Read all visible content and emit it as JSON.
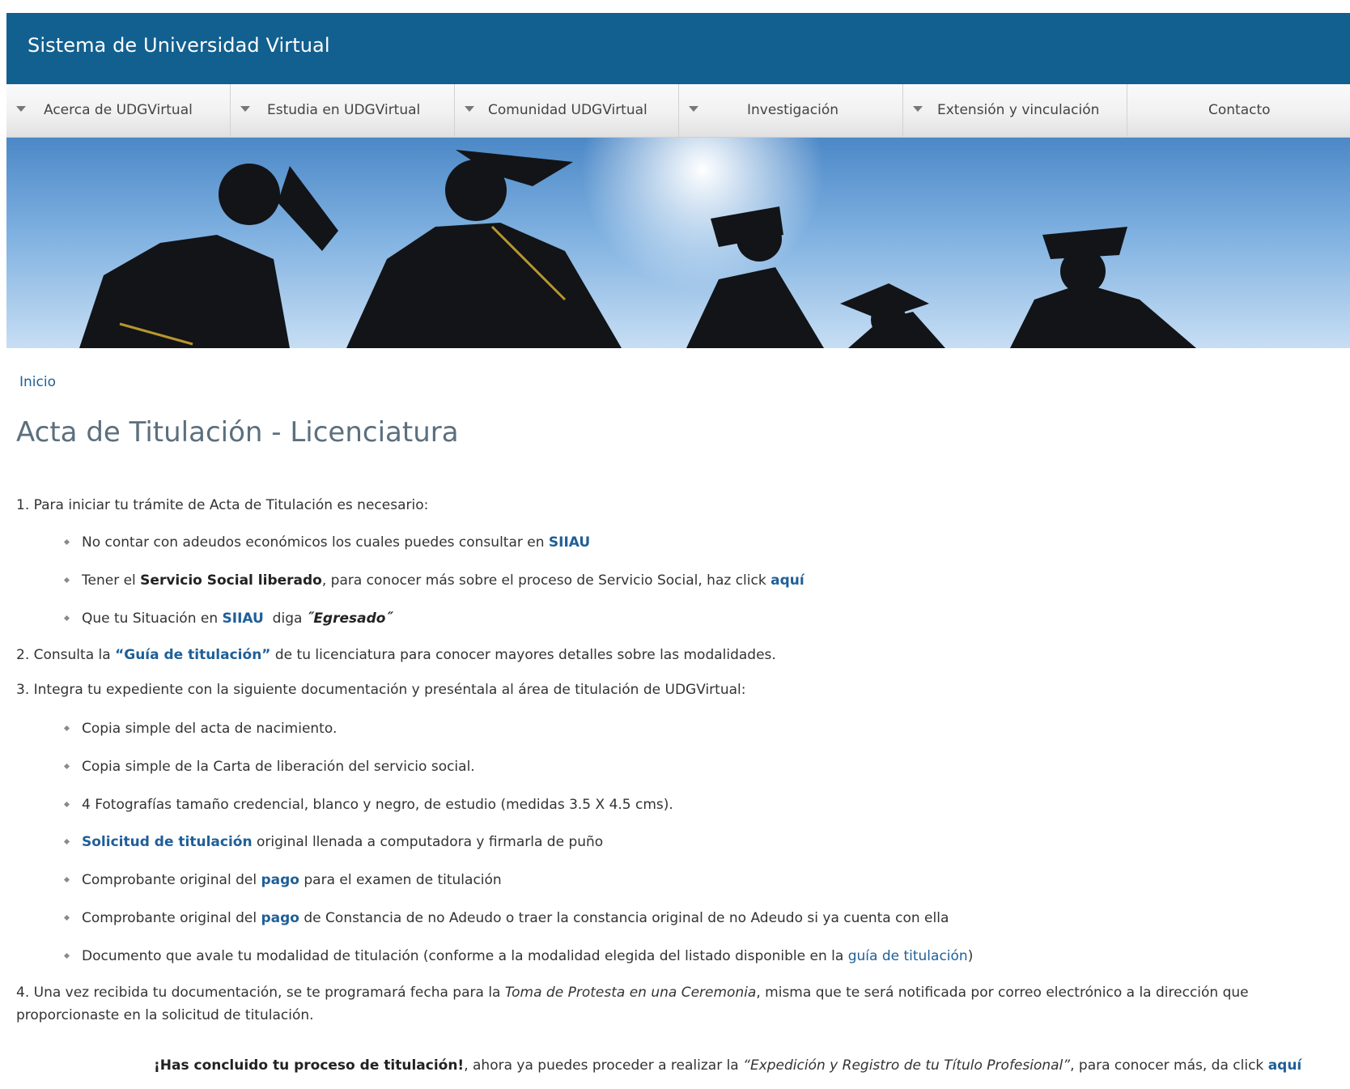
{
  "header": {
    "title": "Sistema de Universidad Virtual"
  },
  "nav": {
    "items": [
      {
        "label": "Acerca de UDGVirtual"
      },
      {
        "label": "Estudia en UDGVirtual"
      },
      {
        "label": "Comunidad UDGVirtual"
      },
      {
        "label": "Investigación"
      },
      {
        "label": "Extensión y vinculación"
      },
      {
        "label": "Contacto"
      }
    ]
  },
  "breadcrumb": {
    "home": "Inicio"
  },
  "page": {
    "title": "Acta de Titulación - Licenciatura"
  },
  "content": {
    "step1": "1. Para iniciar tu trámite de Acta de Titulación es necesario:",
    "b1": {
      "text": "No contar con adeudos económicos los cuales puedes consultar en ",
      "link": "SIIAU"
    },
    "b2": {
      "pre": "Tener el ",
      "bold": "Servicio Social liberado",
      "mid": ", para conocer más sobre el proceso de Servicio Social, haz click ",
      "link": "aquí"
    },
    "b3": {
      "pre": "Que tu Situación en ",
      "link": "SIIAU",
      "mid": "  diga ",
      "quote": "˝Egresado˝"
    },
    "step2": {
      "pre": "2. Consulta la ",
      "link": "“Guía de titulación”",
      "post": " de tu licenciatura para conocer mayores detalles sobre las modalidades."
    },
    "step3": "3. Integra tu expediente con la siguiente documentación y preséntala al área de titulación de UDGVirtual:",
    "d1": "Copia simple del acta de nacimiento.",
    "d2": "Copia simple de la Carta de liberación del servicio social.",
    "d3": "4 Fotografías tamaño credencial, blanco y negro, de estudio (medidas 3.5 X 4.5 cms).",
    "d4": {
      "link": "Solicitud de titulación",
      "post": " original llenada a computadora y firmarla de puño"
    },
    "d5": {
      "pre": "Comprobante original del ",
      "link": "pago",
      "post": " para el examen de titulación"
    },
    "d6": {
      "pre": "Comprobante original del ",
      "link": "pago",
      "post": " de Constancia de no Adeudo o traer la constancia original de no Adeudo si ya cuenta con ella"
    },
    "d7": {
      "pre": "Documento que avale tu modalidad de titulación (conforme a la modalidad elegida del listado disponible en la ",
      "link": "guía de titulación",
      "post": ")"
    },
    "step4": {
      "pre": "4. Una vez recibida tu documentación, se te programará fecha para la ",
      "em": "Toma de Protesta en una Ceremonia",
      "post": ", misma que te será notificada por correo electrónico a la dirección que proporcionaste en la solicitud de titulación."
    },
    "final": {
      "bold": "¡Has concluido tu proceso de titulación!",
      "mid": ", ahora ya puedes proceder a realizar la ",
      "em": "“Expedición y Registro de tu Título Profesional”",
      "mid2": ", para conocer más, da click ",
      "link": "aquí"
    }
  }
}
